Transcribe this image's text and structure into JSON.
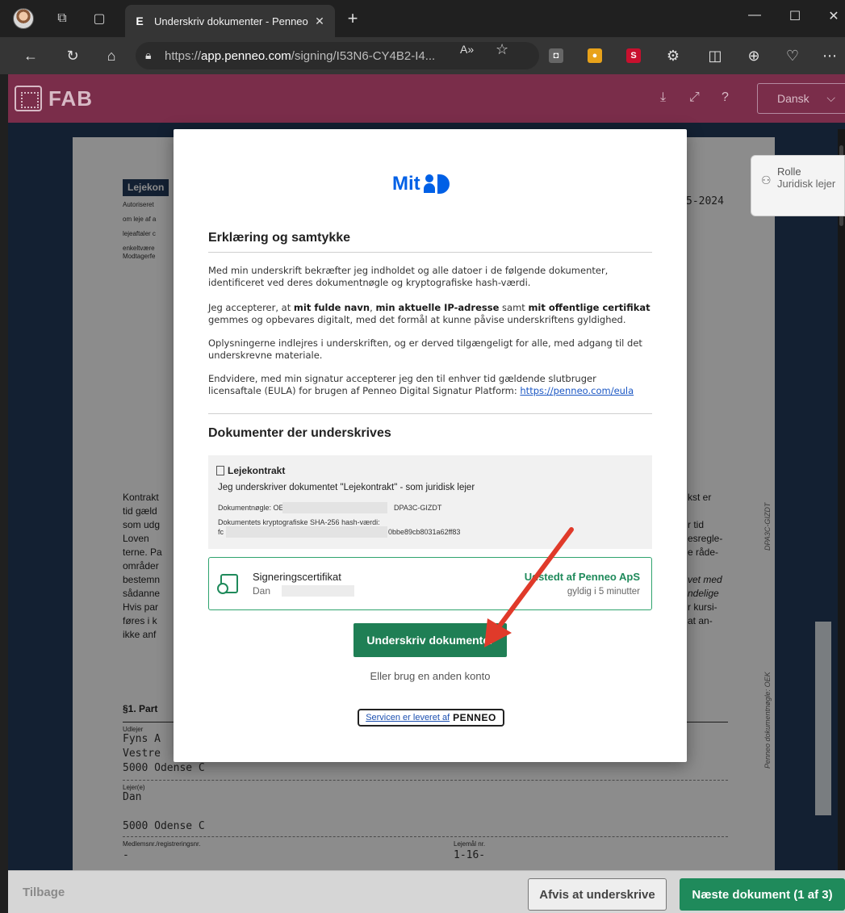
{
  "browser": {
    "tab_title": "Underskriv dokumenter - Penneo",
    "tab_favicon": "E",
    "url_prefix": "https://",
    "url_domain": "app.penneo.com",
    "url_path": "/signing/I53N6-CY4B2-I4..."
  },
  "app": {
    "logo_text": "FAB",
    "language": "Dansk",
    "brand_color": "#7a2d4a"
  },
  "role": {
    "label": "Rolle",
    "value": "Juridisk lejer"
  },
  "document_bg": {
    "title_fragment": "Lejekon",
    "date_fragment": "5-2024",
    "lines_left": [
      "Autoriseret",
      "om leje af a",
      "lejeaftaler c",
      "enkeltvære",
      "Modtagerfe"
    ],
    "body_left": [
      "Kontrakt",
      "tid gæld",
      "som udg",
      "   Loven",
      "terne. Pa",
      "områder",
      "bestemn",
      "sådanne",
      "Hvis par",
      "føres i k",
      "ikke anf"
    ],
    "body_right": [
      "kst er",
      "",
      "r tid",
      "esregle-",
      "e råde-",
      "",
      "vet med",
      "ndelige",
      "r kursi-",
      "at an-"
    ],
    "section": "§1. Part",
    "udlejer_label": "Udlejer",
    "udlejer_lines": [
      "Fyns A",
      "Vestre",
      "5000  Odense C"
    ],
    "lejer_label": "Lejer(e)",
    "lejer_lines": [
      "Dan",
      "",
      "5000 Odense C"
    ],
    "member_label": "Medlemsnr./registreringsnr.",
    "member_value": "-",
    "lejemaal_label": "Lejemål nr.",
    "lejemaal_value": "1-16-",
    "vertical_text": "Penneo dokumentnøgle: OEK",
    "vertical_text_2": "DPA3C-GIZDT"
  },
  "modal": {
    "section1_title": "Erklæring og samtykke",
    "p1": "Med min underskrift bekræfter jeg indholdet og alle datoer i de følgende dokumenter, identificeret ved deres dokumentnøgle og kryptografiske hash-værdi.",
    "p2_a": "Jeg accepterer, at ",
    "p2_b": "mit fulde navn",
    "p2_c": ", ",
    "p2_d": "min aktuelle IP-adresse",
    "p2_e": " samt ",
    "p2_f": "mit offentlige certifikat",
    "p2_g": " gemmes og opbevares digitalt, med det formål at kunne påvise underskriftens gyldighed.",
    "p3": "Oplysningerne indlejres i underskriften, og er derved tilgængeligt for alle, med adgang til det underskrevne materiale.",
    "p4": "Endvidere, med min signatur accepterer jeg den til enhver tid gældende slutbruger licensaftale (EULA) for brugen af Penneo Digital Signatur Platform: ",
    "p4_link": "https://penneo.com/eula",
    "section2_title": "Dokumenter der underskrives",
    "doc_title": "Lejekontrakt",
    "doc_line": "Jeg underskriver dokumentet \"Lejekontrakt\" - som juridisk lejer",
    "doc_key_label": "Dokumentnøgle: OEKGV-8",
    "doc_key_end": "DPA3C-GIZDT",
    "doc_hash_label": "Dokumentets kryptografiske SHA-256 hash-værdi:",
    "doc_hash_prefix": "fc",
    "doc_hash_end": "0bbe89cb8031a62ff83",
    "cert_title": "Signeringscertifikat",
    "cert_name": "Dan",
    "cert_issuer": "Udstedt af Penneo ApS",
    "cert_validity": "gyldig i 5 minutter",
    "sign_button": "Underskriv dokumenter",
    "other_account": "Eller brug en anden konto",
    "service_text": "Servicen er leveret af",
    "service_brand": "PENNEO",
    "accent_color": "#1f7f55",
    "mitid_text": "Mit"
  },
  "bottom": {
    "back": "Tilbage",
    "reject": "Afvis at underskrive",
    "next": "Næste dokument (1 af 3)"
  }
}
